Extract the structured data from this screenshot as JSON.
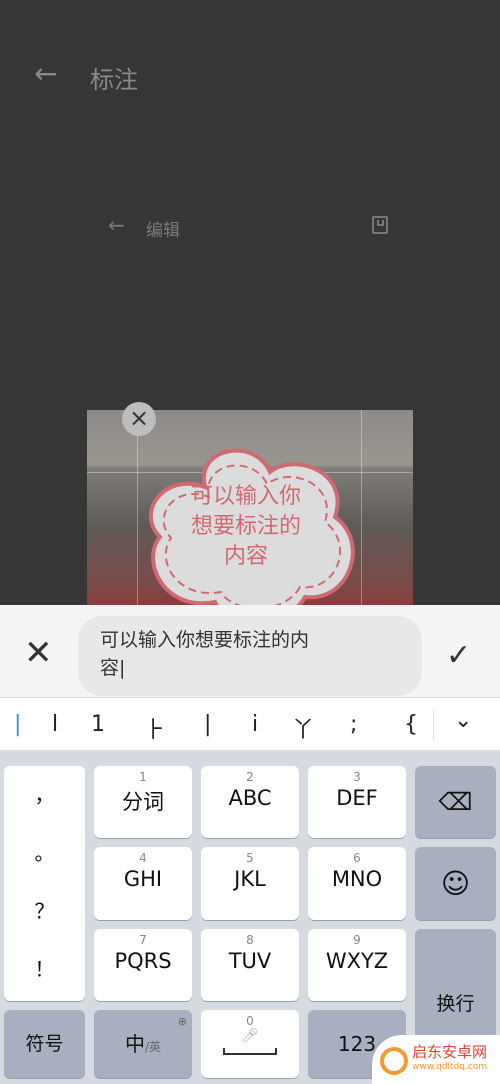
{
  "header": {
    "title": "标注"
  },
  "editor": {
    "title": "编辑"
  },
  "annotation": {
    "bubble_text": "可以输入你想要标注的内容",
    "bubble_color": "#d06a72"
  },
  "input": {
    "value_line1": "可以输入你想要标注的内",
    "value_line2": "容"
  },
  "candidates": [
    "|",
    "l",
    "1",
    "⺊",
    "|",
    "i",
    "丫",
    ";",
    "{"
  ],
  "keyboard": {
    "punct": [
      "，",
      "。",
      "？",
      "！"
    ],
    "keys": [
      {
        "num": "1",
        "label": "分词"
      },
      {
        "num": "2",
        "label": "ABC"
      },
      {
        "num": "3",
        "label": "DEF"
      },
      {
        "num": "4",
        "label": "GHI"
      },
      {
        "num": "5",
        "label": "JKL"
      },
      {
        "num": "6",
        "label": "MNO"
      },
      {
        "num": "7",
        "label": "PQRS"
      },
      {
        "num": "8",
        "label": "TUV"
      },
      {
        "num": "9",
        "label": "WXYZ"
      }
    ],
    "symbol": "符号",
    "lang_main": "中",
    "lang_alt": "/英",
    "space_num": "0",
    "num_key": "123",
    "enter": "换行"
  },
  "watermark": {
    "name": "启东安卓网",
    "url": "www.qdltdq.com"
  }
}
